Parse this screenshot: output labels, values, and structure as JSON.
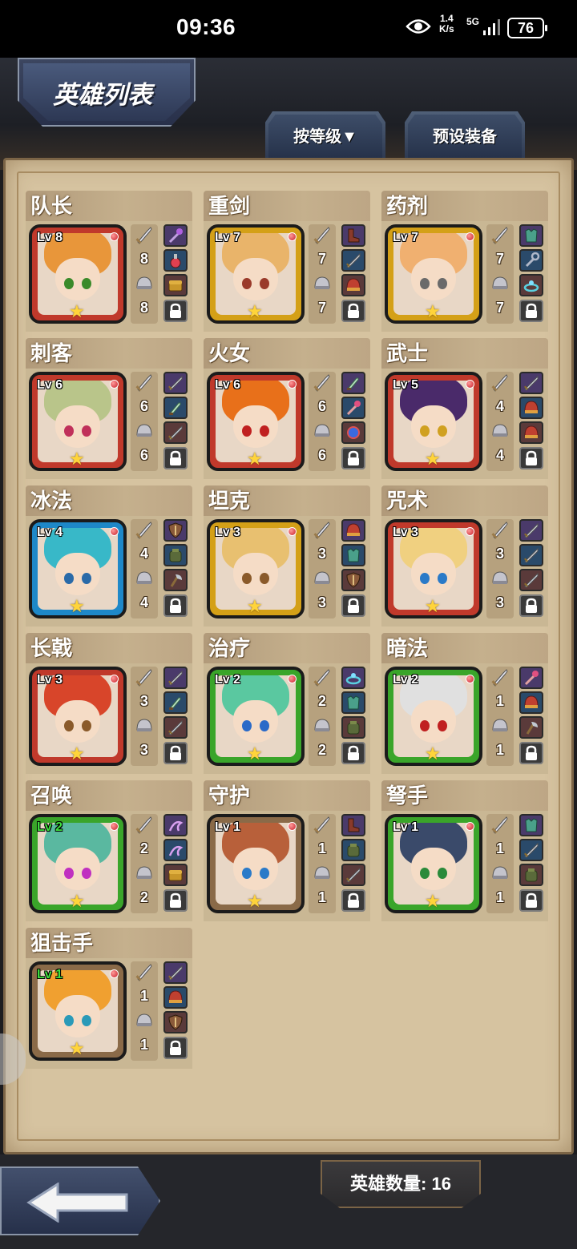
{
  "status_bar": {
    "time": "09:36",
    "net_speed_value": "1.4",
    "net_speed_unit": "K/s",
    "network": "5G",
    "battery": "76"
  },
  "header": {
    "title": "英雄列表",
    "sort_tab": "按等级▼",
    "preset_tab": "预设装备"
  },
  "footer": {
    "hero_count": "英雄数量: 16"
  },
  "colors": {
    "frame_red": "#c0392b",
    "frame_gold": "#d4a017",
    "frame_blue": "#1e88c8",
    "frame_green": "#3aa52a",
    "frame_brown": "#8a6a48"
  },
  "heroes": [
    {
      "role": "队长",
      "level": "Lv 8",
      "attack": "8",
      "defense": "8",
      "frame": "#c0392b",
      "hair": "#e8963a",
      "eyes": "#3a8a2a",
      "lv_color": "white",
      "equip": [
        "staff-icon",
        "potion-icon",
        "chest-icon"
      ]
    },
    {
      "role": "重剑",
      "level": "Lv 7",
      "attack": "7",
      "defense": "7",
      "frame": "#d4a017",
      "hair": "#e9b46a",
      "eyes": "#9a3a2a",
      "lv_color": "white",
      "equip": [
        "boots-icon",
        "sword-icon",
        "helmet-icon"
      ]
    },
    {
      "role": "药剂",
      "level": "Lv 7",
      "attack": "7",
      "defense": "7",
      "frame": "#d4a017",
      "hair": "#f0b070",
      "eyes": "#6a6a6a",
      "lv_color": "white",
      "equip": [
        "armor-icon",
        "wrench-icon",
        "ring-icon"
      ]
    },
    {
      "role": "刺客",
      "level": "Lv 6",
      "attack": "6",
      "defense": "6",
      "frame": "#c0392b",
      "hair": "#b9c58a",
      "eyes": "#c0305a",
      "lv_color": "white",
      "equip": [
        "sword-icon",
        "dagger-icon",
        "sword-icon"
      ]
    },
    {
      "role": "火女",
      "level": "Lv 6",
      "attack": "6",
      "defense": "6",
      "frame": "#c0392b",
      "hair": "#e8701a",
      "eyes": "#c02020",
      "lv_color": "white",
      "equip": [
        "dagger-icon",
        "wand-icon",
        "orb-icon"
      ]
    },
    {
      "role": "武士",
      "level": "Lv 5",
      "attack": "4",
      "defense": "4",
      "frame": "#c0392b",
      "hair": "#4a2a6a",
      "eyes": "#d0a020",
      "lv_color": "white",
      "equip": [
        "sword-icon",
        "helmet-icon",
        "helmet-icon"
      ]
    },
    {
      "role": "冰法",
      "level": "Lv 4",
      "attack": "4",
      "defense": "4",
      "frame": "#1e88c8",
      "hair": "#38b8c8",
      "eyes": "#2a6aa8",
      "lv_color": "white",
      "equip": [
        "shield-icon",
        "bag-icon",
        "axe-icon"
      ]
    },
    {
      "role": "坦克",
      "level": "Lv 3",
      "attack": "3",
      "defense": "3",
      "frame": "#d4a017",
      "hair": "#e8c070",
      "eyes": "#8a5a2a",
      "lv_color": "white",
      "equip": [
        "helmet-icon",
        "armor-icon",
        "shield-icon"
      ]
    },
    {
      "role": "咒术",
      "level": "Lv 3",
      "attack": "3",
      "defense": "3",
      "frame": "#c0392b",
      "hair": "#f0d080",
      "eyes": "#2a7ac8",
      "lv_color": "white",
      "equip": [
        "sword-icon",
        "sword-icon",
        "sword-icon"
      ]
    },
    {
      "role": "长戟",
      "level": "Lv 3",
      "attack": "3",
      "defense": "3",
      "frame": "#c0392b",
      "hair": "#d8452a",
      "eyes": "#8a5a2a",
      "lv_color": "white",
      "equip": [
        "sword-icon",
        "dagger-icon",
        "sword-icon"
      ]
    },
    {
      "role": "治疗",
      "level": "Lv 2",
      "attack": "2",
      "defense": "2",
      "frame": "#3aa52a",
      "hair": "#5ac8a0",
      "eyes": "#2a6ac8",
      "lv_color": "white",
      "equip": [
        "ring-icon",
        "armor-icon",
        "bag-icon"
      ]
    },
    {
      "role": "暗法",
      "level": "Lv 2",
      "attack": "1",
      "defense": "1",
      "frame": "#3aa52a",
      "hair": "#e0e0e0",
      "eyes": "#c02020",
      "lv_color": "white",
      "equip": [
        "wand-icon",
        "helmet-icon",
        "axe-icon"
      ]
    },
    {
      "role": "召唤",
      "level": "Lv 2",
      "attack": "2",
      "defense": "2",
      "frame": "#3aa52a",
      "hair": "#5ab8a0",
      "eyes": "#c030c0",
      "lv_color": "green",
      "equip": [
        "whip-icon",
        "whip-icon",
        "chest-icon"
      ]
    },
    {
      "role": "守护",
      "level": "Lv 1",
      "attack": "1",
      "defense": "1",
      "frame": "#8a6a48",
      "hair": "#b8603a",
      "eyes": "#2a7ac8",
      "lv_color": "white",
      "equip": [
        "boots-icon",
        "bag-icon",
        "sword-icon"
      ]
    },
    {
      "role": "弩手",
      "level": "Lv 1",
      "attack": "1",
      "defense": "1",
      "frame": "#3aa52a",
      "hair": "#3a4a6a",
      "eyes": "#2a8a3a",
      "lv_color": "white",
      "equip": [
        "armor-icon",
        "sword-icon",
        "bag-icon"
      ]
    },
    {
      "role": "狙击手",
      "level": "Lv 1",
      "attack": "1",
      "defense": "1",
      "frame": "#8a6a48",
      "hair": "#f0a030",
      "eyes": "#2a9ab8",
      "lv_color": "green",
      "equip": [
        "sword-icon",
        "helmet-icon",
        "shield-icon"
      ]
    }
  ]
}
